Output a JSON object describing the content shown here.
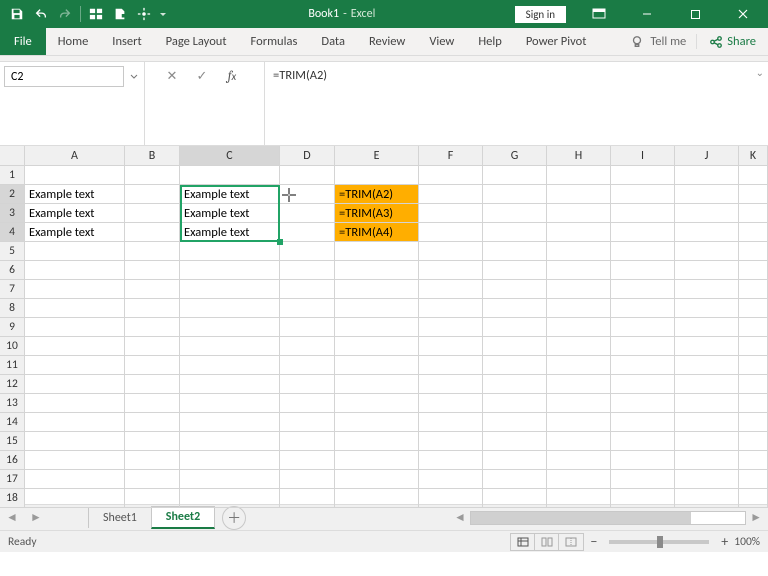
{
  "title": {
    "doc": "Book1",
    "app": "Excel"
  },
  "qat": {},
  "window": {
    "signin": "Sign in"
  },
  "ribbon": {
    "tabs": {
      "file": "File",
      "home": "Home",
      "insert": "Insert",
      "pagelayout": "Page Layout",
      "formulas": "Formulas",
      "data": "Data",
      "review": "Review",
      "view": "View",
      "help": "Help",
      "powerpivot": "Power Pivot"
    },
    "tellme": "Tell me",
    "share": "Share"
  },
  "fn": {
    "namebox": "C2",
    "formula": "=TRIM(A2)"
  },
  "grid": {
    "cols": [
      "A",
      "B",
      "C",
      "D",
      "E",
      "F",
      "G",
      "H",
      "I",
      "J",
      "K"
    ],
    "active_col": "C",
    "active_rows_start": 2,
    "active_rows_end": 4,
    "A2": "Example text",
    "A3": "Example   text",
    "A4": "Example   text",
    "C2": "Example text",
    "C3": "Example text",
    "C4": "Example   text",
    "E2": "=TRIM(A2)",
    "E3": "=TRIM(A3)",
    "E4": "=TRIM(A4)"
  },
  "sheets": {
    "s1": "Sheet1",
    "s2": "Sheet2"
  },
  "status": {
    "ready": "Ready",
    "zoom": "100%"
  }
}
